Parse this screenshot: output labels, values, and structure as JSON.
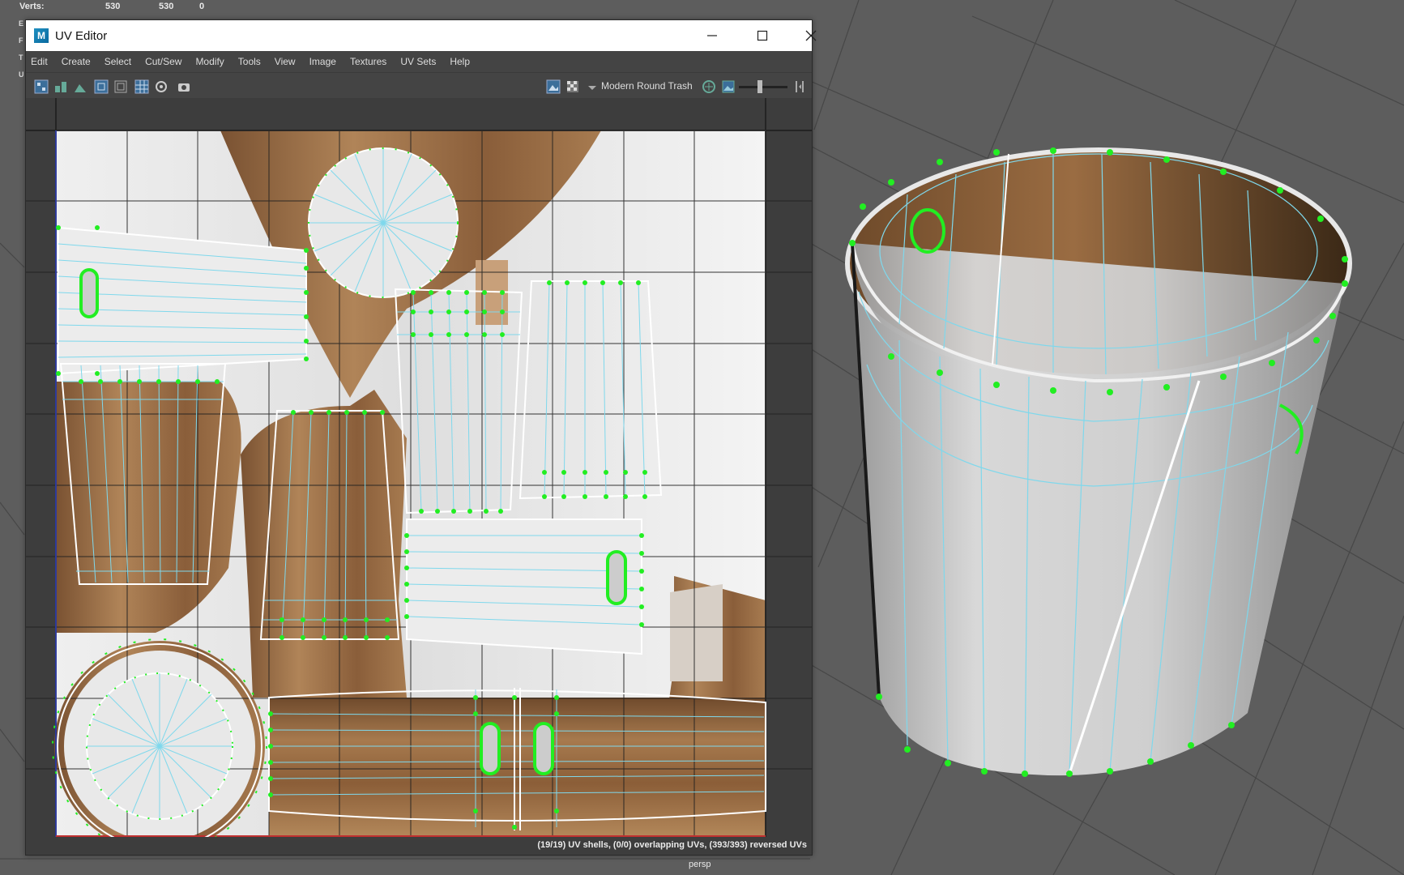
{
  "hud": {
    "verts_label": "Verts:",
    "verts_values": [
      "530",
      "530",
      "0"
    ],
    "side_letters": [
      "E",
      "F",
      "T",
      "U"
    ]
  },
  "viewport": {
    "camera_label": "persp"
  },
  "window": {
    "title": "UV Editor",
    "logo_letter": "M",
    "minimize_icon": "minimize-icon",
    "maximize_icon": "maximize-icon",
    "close_icon": "close-icon"
  },
  "menu": [
    "Edit",
    "Create",
    "Select",
    "Cut/Sew",
    "Modify",
    "Tools",
    "View",
    "Image",
    "Textures",
    "UV Sets",
    "Help"
  ],
  "toolbar": {
    "texture_name": "Modern Round Trash",
    "icons": [
      "uv-shell-icon",
      "uv-grid-icon",
      "uv-layout-icon",
      "frame-icon",
      "frame-all-icon",
      "grid-toggle-icon",
      "isolate-icon",
      "snapshot-icon",
      "image-display-icon",
      "checker-icon",
      "dropdown-icon",
      "texture-link-icon",
      "image-icon",
      "exposure-slider",
      "split-icon"
    ]
  },
  "status": {
    "text": "(19/19) UV shells, (0/0) overlapping UVs, (393/393) reversed UVs"
  },
  "colors": {
    "viewport_bg": "#5d5d5d",
    "uv_edge": "#7fd8ec",
    "uv_vertex": "#22ee22",
    "shell_border": "#ffffff",
    "wood_dark": "#7a5232",
    "wood_light": "#b08458",
    "metal_light": "#eaeaea"
  }
}
